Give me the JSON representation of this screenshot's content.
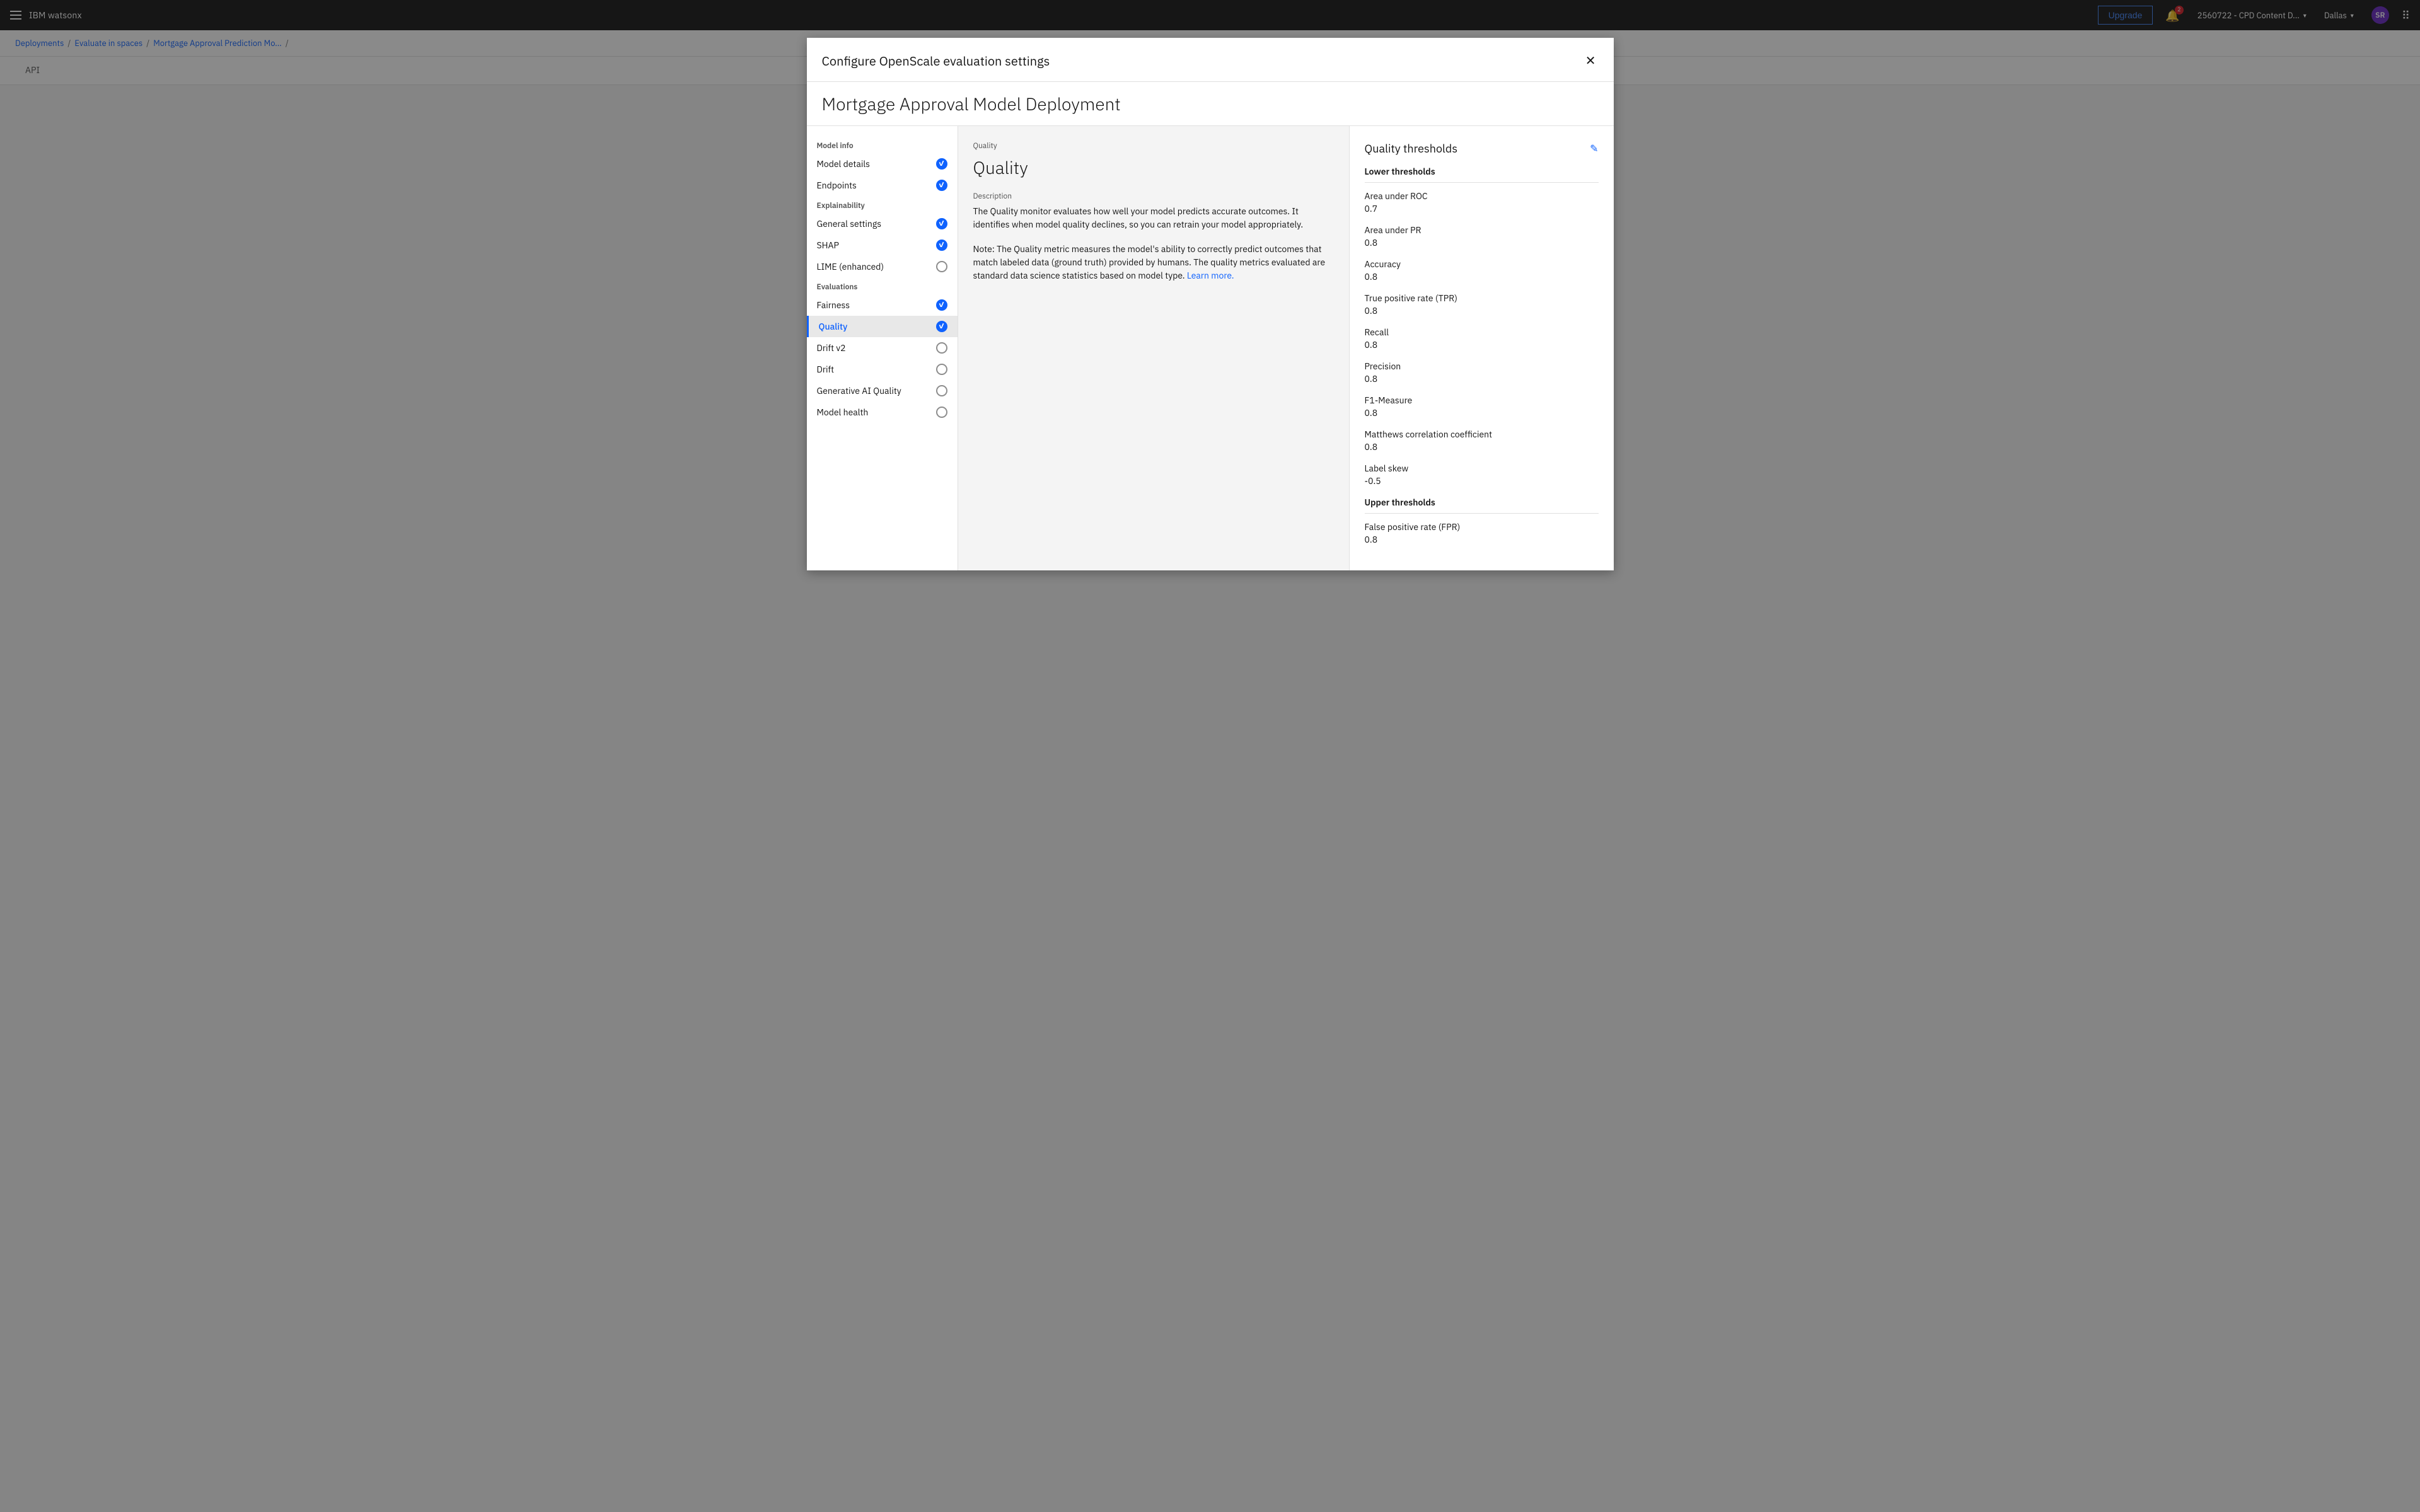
{
  "navbar": {
    "menu_label": "Menu",
    "brand": "IBM watsonx",
    "upgrade_label": "Upgrade",
    "notifications_count": "2",
    "account": "2560722 - CPD Content D...",
    "region": "Dallas",
    "avatar_initials": "SR",
    "grid_label": "App switcher"
  },
  "breadcrumb": {
    "items": [
      {
        "label": "Deployments",
        "link": true
      },
      {
        "label": "Evaluate in spaces",
        "link": true
      },
      {
        "label": "Mortgage Approval Prediction Mo...",
        "link": true
      },
      {
        "label": "",
        "link": false
      }
    ]
  },
  "page_tabs": [
    {
      "label": "API",
      "active": false
    }
  ],
  "modal": {
    "title": "Configure OpenScale evaluation settings",
    "subtitle": "Mortgage Approval Model Deployment",
    "close_label": "Close"
  },
  "sidebar": {
    "sections": [
      {
        "label": "Model info",
        "items": [
          {
            "label": "Model details",
            "checked": true,
            "active": false
          },
          {
            "label": "Endpoints",
            "checked": true,
            "active": false
          }
        ]
      },
      {
        "label": "Explainability",
        "items": [
          {
            "label": "General settings",
            "checked": true,
            "active": false
          },
          {
            "label": "SHAP",
            "checked": true,
            "active": false
          },
          {
            "label": "LIME (enhanced)",
            "checked": false,
            "active": false
          }
        ]
      },
      {
        "label": "Evaluations",
        "items": [
          {
            "label": "Fairness",
            "checked": true,
            "active": false
          },
          {
            "label": "Quality",
            "checked": true,
            "active": true
          },
          {
            "label": "Drift v2",
            "checked": false,
            "active": false
          },
          {
            "label": "Drift",
            "checked": false,
            "active": false
          },
          {
            "label": "Generative AI Quality",
            "checked": false,
            "active": false
          },
          {
            "label": "Model health",
            "checked": false,
            "active": false
          }
        ]
      }
    ]
  },
  "content": {
    "breadcrumb": "Quality",
    "heading": "Quality",
    "description_label": "Description",
    "description_p1": "The Quality monitor evaluates how well your model predicts accurate outcomes. It identifies when model quality declines, so you can retrain your model appropriately.",
    "description_p2": "Note: The Quality metric measures the model's ability to correctly predict outcomes that match labeled data (ground truth) provided by humans. The quality metrics evaluated are standard data science statistics based on model type.",
    "learn_more_link": "Learn more."
  },
  "thresholds": {
    "title": "Quality thresholds",
    "edit_label": "Edit",
    "lower_section": "Lower thresholds",
    "upper_section": "Upper thresholds",
    "lower_items": [
      {
        "name": "Area under ROC",
        "value": "0.7"
      },
      {
        "name": "Area under PR",
        "value": "0.8"
      },
      {
        "name": "Accuracy",
        "value": "0.8"
      },
      {
        "name": "True positive rate (TPR)",
        "value": "0.8"
      },
      {
        "name": "Recall",
        "value": "0.8"
      },
      {
        "name": "Precision",
        "value": "0.8"
      },
      {
        "name": "F1-Measure",
        "value": "0.8"
      },
      {
        "name": "Matthews correlation coefficient",
        "value": "0.8"
      },
      {
        "name": "Label skew",
        "value": "-0.5"
      }
    ],
    "upper_items": [
      {
        "name": "False positive rate (FPR)",
        "value": "0.8"
      }
    ]
  }
}
